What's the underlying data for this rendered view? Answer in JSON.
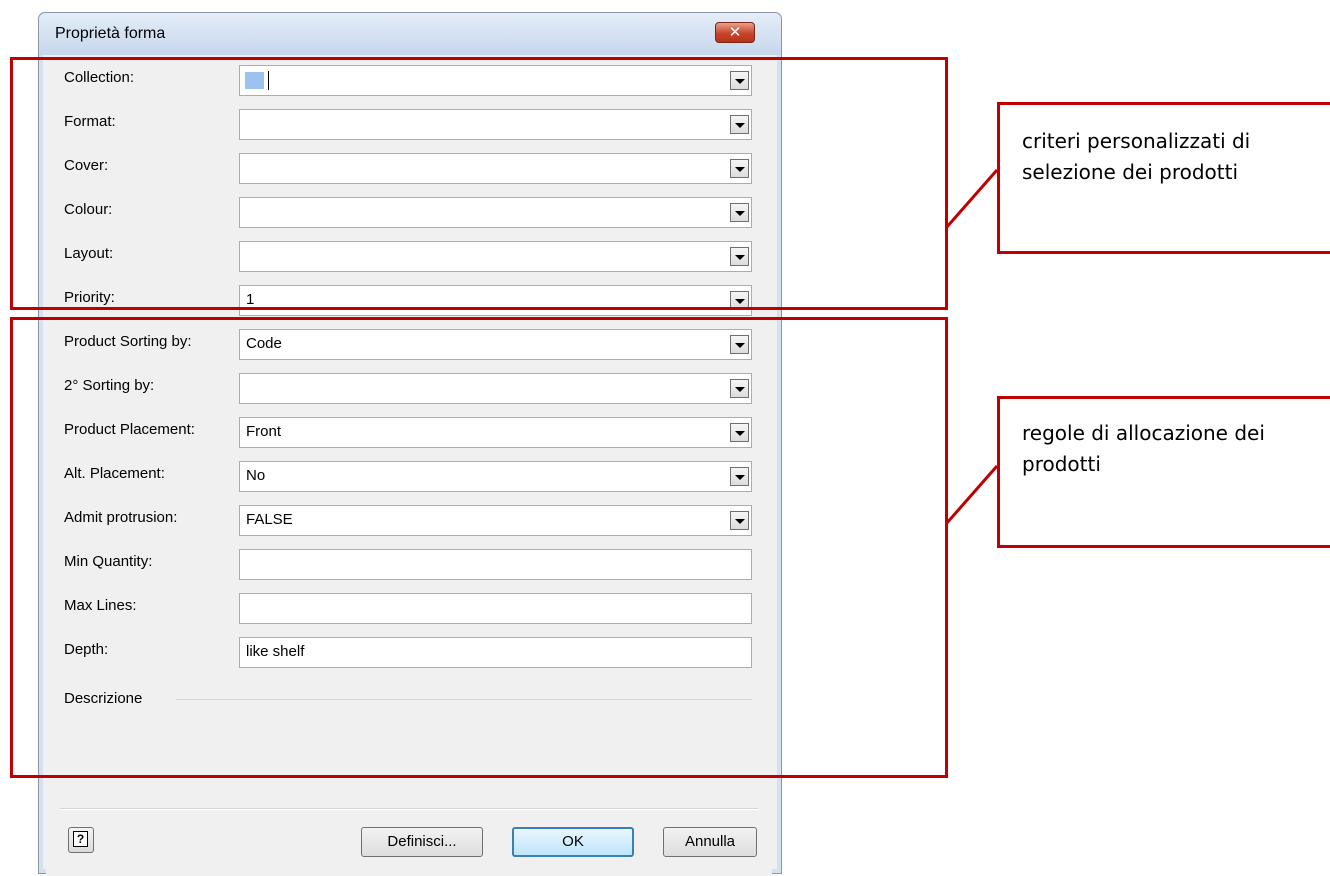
{
  "dialog": {
    "title": "Proprietà forma",
    "close_icon": "✕"
  },
  "form": {
    "rows": [
      {
        "label": "Collection:",
        "value": ""
      },
      {
        "label": "Format:",
        "value": ""
      },
      {
        "label": "Cover:",
        "value": ""
      },
      {
        "label": "Colour:",
        "value": ""
      },
      {
        "label": "Layout:",
        "value": ""
      },
      {
        "label": "Priority:",
        "value": "1"
      },
      {
        "label": "Product Sorting by:",
        "value": "Code"
      },
      {
        "label": "2° Sorting by:",
        "value": ""
      },
      {
        "label": "Product Placement:",
        "value": "Front"
      },
      {
        "label": "Alt. Placement:",
        "value": "No"
      },
      {
        "label": "Admit protrusion:",
        "value": "FALSE"
      },
      {
        "label": "Min Quantity:",
        "value": ""
      },
      {
        "label": "Max Lines:",
        "value": ""
      },
      {
        "label": "Depth:",
        "value": "like shelf"
      }
    ],
    "description_label": "Descrizione"
  },
  "buttons": {
    "help": "?",
    "define": "Definisci...",
    "ok": "OK",
    "cancel": "Annulla"
  },
  "annotations": {
    "top_note_line1": "criteri personalizzati di",
    "top_note_line2": "selezione dei prodotti",
    "bottom_note_line1": "regole di allocazione dei",
    "bottom_note_line2": "prodotti"
  },
  "colors": {
    "annotation_red": "#c00000",
    "selection_blue": "#9cc3ee"
  }
}
